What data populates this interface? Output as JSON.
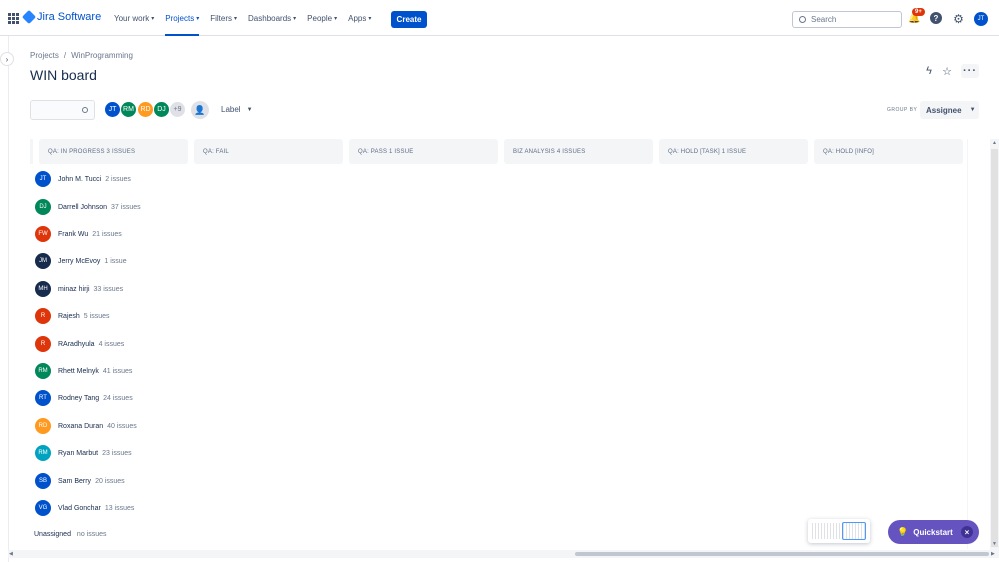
{
  "app": {
    "name": "Jira Software"
  },
  "nav": {
    "items": [
      {
        "label": "Your work",
        "active": false
      },
      {
        "label": "Projects",
        "active": true
      },
      {
        "label": "Filters",
        "active": false
      },
      {
        "label": "Dashboards",
        "active": false
      },
      {
        "label": "People",
        "active": false
      },
      {
        "label": "Apps",
        "active": false
      }
    ],
    "create_label": "Create",
    "search_placeholder": "Search",
    "notification_count": "9+",
    "user_initials": "JT"
  },
  "breadcrumb": {
    "projects": "Projects",
    "separator": "/",
    "project": "WinProgramming"
  },
  "page": {
    "title": "WIN board"
  },
  "filters": {
    "avatars": [
      {
        "initials": "JT",
        "color": "#0052cc"
      },
      {
        "initials": "RM",
        "color": "#00875a"
      },
      {
        "initials": "RD",
        "color": "#ff991f"
      },
      {
        "initials": "DJ",
        "color": "#00875a"
      }
    ],
    "more_count": "+9",
    "label_filter": "Label",
    "group_by_label": "GROUP BY",
    "group_by_value": "Assignee"
  },
  "columns": [
    "QA: IN PROGRESS 3 ISSUES",
    "QA: FAIL",
    "QA: PASS 1 ISSUE",
    "BIZ ANALYSIS 4 ISSUES",
    "QA: HOLD [TASK] 1 ISSUE",
    "QA: HOLD [INFO]"
  ],
  "swimlanes": [
    {
      "initials": "JT",
      "name": "John M. Tucci",
      "count": "2 issues",
      "color": "#0052cc"
    },
    {
      "initials": "DJ",
      "name": "Darrell Johnson",
      "count": "37 issues",
      "color": "#00875a"
    },
    {
      "initials": "FW",
      "name": "Frank Wu",
      "count": "21 issues",
      "color": "#de350b"
    },
    {
      "initials": "JM",
      "name": "Jerry McEvoy",
      "count": "1 issue",
      "color": "#172b4d"
    },
    {
      "initials": "MH",
      "name": "minaz hirji",
      "count": "33 issues",
      "color": "#172b4d"
    },
    {
      "initials": "R",
      "name": "Rajesh",
      "count": "5 issues",
      "color": "#de350b"
    },
    {
      "initials": "R",
      "name": "RAradhyula",
      "count": "4 issues",
      "color": "#de350b"
    },
    {
      "initials": "RM",
      "name": "Rhett Melnyk",
      "count": "41 issues",
      "color": "#00875a"
    },
    {
      "initials": "RT",
      "name": "Rodney Tang",
      "count": "24 issues",
      "color": "#0052cc"
    },
    {
      "initials": "RD",
      "name": "Roxana Duran",
      "count": "40 issues",
      "color": "#ff991f"
    },
    {
      "initials": "RM",
      "name": "Ryan Marbut",
      "count": "23 issues",
      "color": "#00a3bf"
    },
    {
      "initials": "SB",
      "name": "Sam Berry",
      "count": "20 issues",
      "color": "#0052cc"
    },
    {
      "initials": "VG",
      "name": "Vlad Gonchar",
      "count": "13 issues",
      "color": "#0052cc"
    }
  ],
  "unassigned": {
    "name": "Unassigned",
    "count": "no issues"
  },
  "quickstart": {
    "label": "Quickstart",
    "close": "×"
  }
}
